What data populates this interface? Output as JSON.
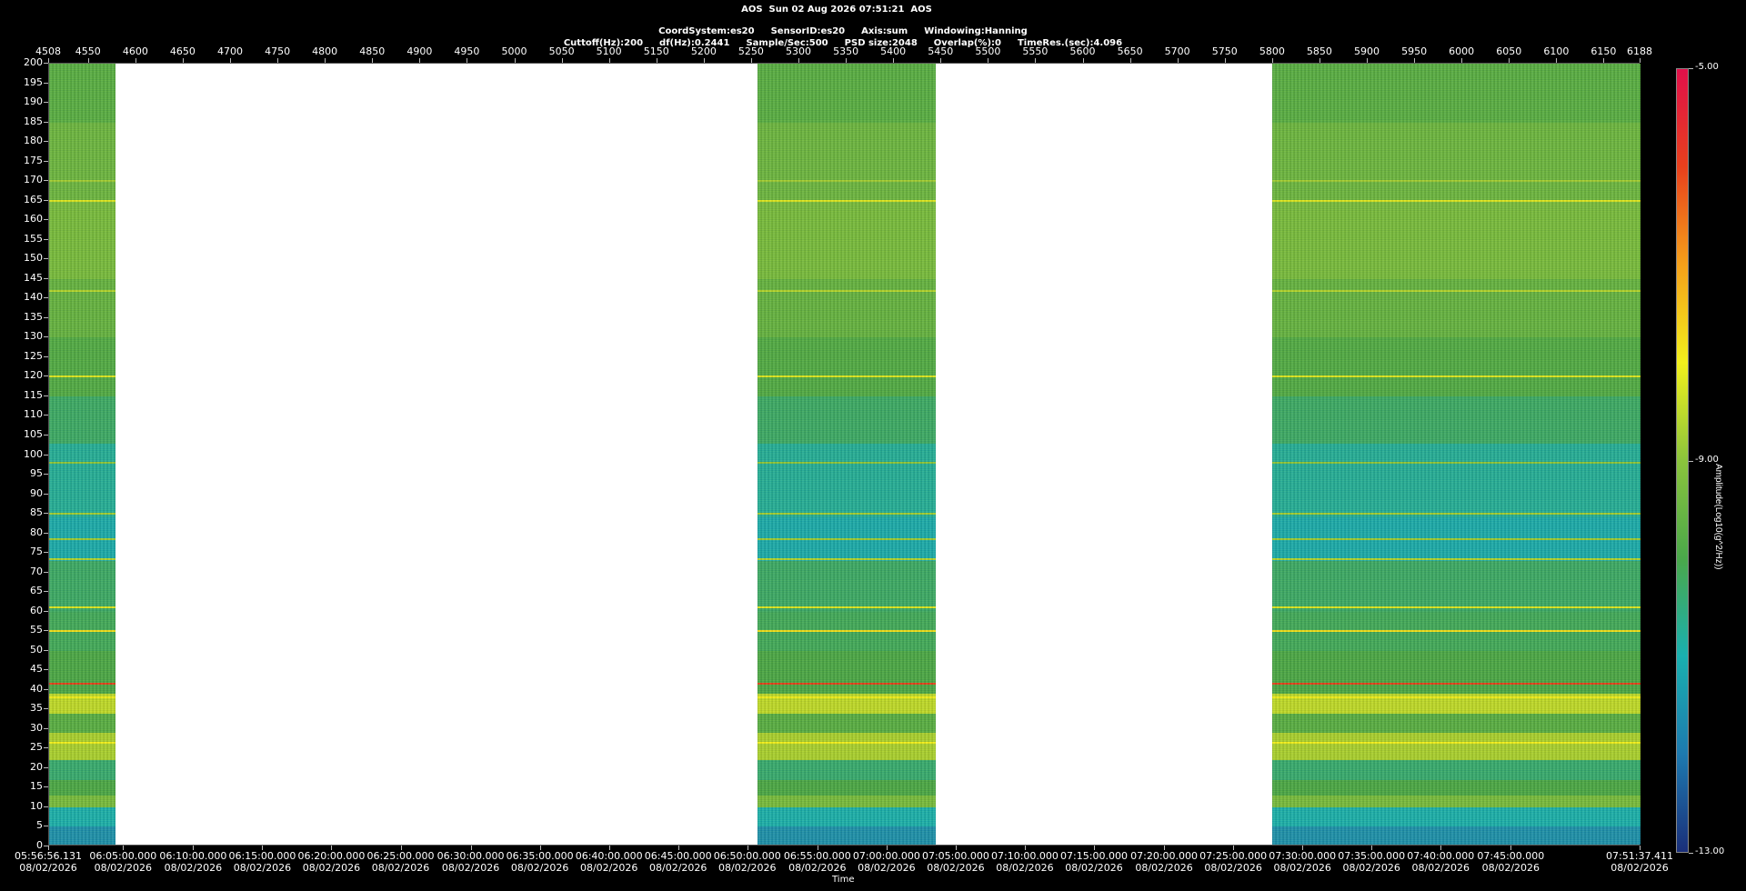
{
  "header": {
    "line1": "AOS  Sun 02 Aug 2026 07:51:21  AOS",
    "line2": [
      "CoordSystem:es20",
      "SensorID:es20",
      "Axis:sum",
      "Windowing:Hanning"
    ],
    "line3": [
      "Cuttoff(Hz):200",
      "df(Hz):0.2441",
      "Sample/Sec:500",
      "PSD size:2048",
      "Overlap(%):0",
      "TimeRes.(sec):4.096"
    ]
  },
  "chart_data": {
    "type": "heatmap",
    "title": "",
    "xlabel": "Time",
    "ylabel": "",
    "colorbar_label": "Amplitude(Log10(g^2/Hz))",
    "colorbar_ticks": [
      "-5.00",
      "-9.00",
      "-13.00"
    ],
    "colorbar_range": [
      -13,
      -5
    ],
    "colormap": [
      "#1a2f7a",
      "#1d7ab0",
      "#19b0b0",
      "#4aa84a",
      "#8bc43c",
      "#f2f01c",
      "#f5a019",
      "#e8401c",
      "#e0104a"
    ],
    "ylim": [
      0,
      200
    ],
    "y_ticks": [
      0,
      5,
      10,
      15,
      20,
      25,
      30,
      35,
      40,
      45,
      50,
      55,
      60,
      65,
      70,
      75,
      80,
      85,
      90,
      95,
      100,
      105,
      110,
      115,
      120,
      125,
      130,
      135,
      140,
      145,
      150,
      155,
      160,
      165,
      170,
      175,
      180,
      185,
      190,
      195,
      200
    ],
    "xlim_index": [
      4508,
      6188
    ],
    "top_x_ticks": [
      4508,
      4550,
      4600,
      4650,
      4700,
      4750,
      4800,
      4850,
      4900,
      4950,
      5000,
      5050,
      5100,
      5150,
      5200,
      5250,
      5300,
      5350,
      5400,
      5450,
      5500,
      5550,
      5600,
      5650,
      5700,
      5750,
      5800,
      5850,
      5900,
      5950,
      6000,
      6050,
      6100,
      6150,
      6188
    ],
    "time_ticks": [
      {
        "idx": 4508,
        "time": "05:56:56.131",
        "date": "08/02/2026"
      },
      {
        "idx": 4587,
        "time": "06:05:00.000",
        "date": "08/02/2026"
      },
      {
        "idx": 4661,
        "time": "06:10:00.000",
        "date": "08/02/2026"
      },
      {
        "idx": 4734,
        "time": "06:15:00.000",
        "date": "08/02/2026"
      },
      {
        "idx": 4807,
        "time": "06:20:00.000",
        "date": "08/02/2026"
      },
      {
        "idx": 4880,
        "time": "06:25:00.000",
        "date": "08/02/2026"
      },
      {
        "idx": 4954,
        "time": "06:30:00.000",
        "date": "08/02/2026"
      },
      {
        "idx": 5027,
        "time": "06:35:00.000",
        "date": "08/02/2026"
      },
      {
        "idx": 5100,
        "time": "06:40:00.000",
        "date": "08/02/2026"
      },
      {
        "idx": 5173,
        "time": "06:45:00.000",
        "date": "08/02/2026"
      },
      {
        "idx": 5246,
        "time": "06:50:00.000",
        "date": "08/02/2026"
      },
      {
        "idx": 5320,
        "time": "06:55:00.000",
        "date": "08/02/2026"
      },
      {
        "idx": 5393,
        "time": "07:00:00.000",
        "date": "08/02/2026"
      },
      {
        "idx": 5466,
        "time": "07:05:00.000",
        "date": "08/02/2026"
      },
      {
        "idx": 5539,
        "time": "07:10:00.000",
        "date": "08/02/2026"
      },
      {
        "idx": 5612,
        "time": "07:15:00.000",
        "date": "08/02/2026"
      },
      {
        "idx": 5686,
        "time": "07:20:00.000",
        "date": "08/02/2026"
      },
      {
        "idx": 5759,
        "time": "07:25:00.000",
        "date": "08/02/2026"
      },
      {
        "idx": 5832,
        "time": "07:30:00.000",
        "date": "08/02/2026"
      },
      {
        "idx": 5905,
        "time": "07:35:00.000",
        "date": "08/02/2026"
      },
      {
        "idx": 5978,
        "time": "07:40:00.000",
        "date": "08/02/2026"
      },
      {
        "idx": 6052,
        "time": "07:45:00.000",
        "date": "08/02/2026"
      },
      {
        "idx": 6188,
        "time": "07:51:37.411",
        "date": "08/02/2026"
      }
    ],
    "data_segments": [
      {
        "start": 4508,
        "end": 4578
      },
      {
        "start": 5256,
        "end": 5444
      },
      {
        "start": 5799,
        "end": 6188
      }
    ],
    "frequency_bands": [
      {
        "from": 0,
        "to": 5,
        "level": -11.6
      },
      {
        "from": 5,
        "to": 10,
        "level": -11.0
      },
      {
        "from": 10,
        "to": 13,
        "level": -9.3
      },
      {
        "from": 13,
        "to": 17,
        "level": -10.0
      },
      {
        "from": 17,
        "to": 22,
        "level": -10.4
      },
      {
        "from": 22,
        "to": 29,
        "level": -8.7
      },
      {
        "from": 29,
        "to": 34,
        "level": -9.8
      },
      {
        "from": 34,
        "to": 39,
        "level": -8.5
      },
      {
        "from": 39,
        "to": 50,
        "level": -10.0
      },
      {
        "from": 50,
        "to": 60,
        "level": -10.2
      },
      {
        "from": 60,
        "to": 73,
        "level": -10.3
      },
      {
        "from": 73,
        "to": 84,
        "level": -11.1
      },
      {
        "from": 84,
        "to": 103,
        "level": -10.8
      },
      {
        "from": 103,
        "to": 115,
        "level": -10.3
      },
      {
        "from": 115,
        "to": 130,
        "level": -9.9
      },
      {
        "from": 130,
        "to": 145,
        "level": -9.6
      },
      {
        "from": 145,
        "to": 165,
        "level": -9.3
      },
      {
        "from": 165,
        "to": 185,
        "level": -9.5
      },
      {
        "from": 185,
        "to": 200,
        "level": -9.8
      }
    ],
    "tonal_lines": [
      {
        "freq": 26.5,
        "level": -8.0
      },
      {
        "freq": 38.0,
        "level": -8.0
      },
      {
        "freq": 41.5,
        "level": -6.0
      },
      {
        "freq": 55.0,
        "level": -7.8
      },
      {
        "freq": 61.0,
        "level": -8.2
      },
      {
        "freq": 73.5,
        "level": -8.6
      },
      {
        "freq": 78.5,
        "level": -8.8
      },
      {
        "freq": 85.0,
        "level": -8.8
      },
      {
        "freq": 98.0,
        "level": -9.0
      },
      {
        "freq": 120.0,
        "level": -8.2
      },
      {
        "freq": 142.0,
        "level": -8.6
      },
      {
        "freq": 165.0,
        "level": -8.2
      },
      {
        "freq": 170.0,
        "level": -8.8
      }
    ]
  }
}
